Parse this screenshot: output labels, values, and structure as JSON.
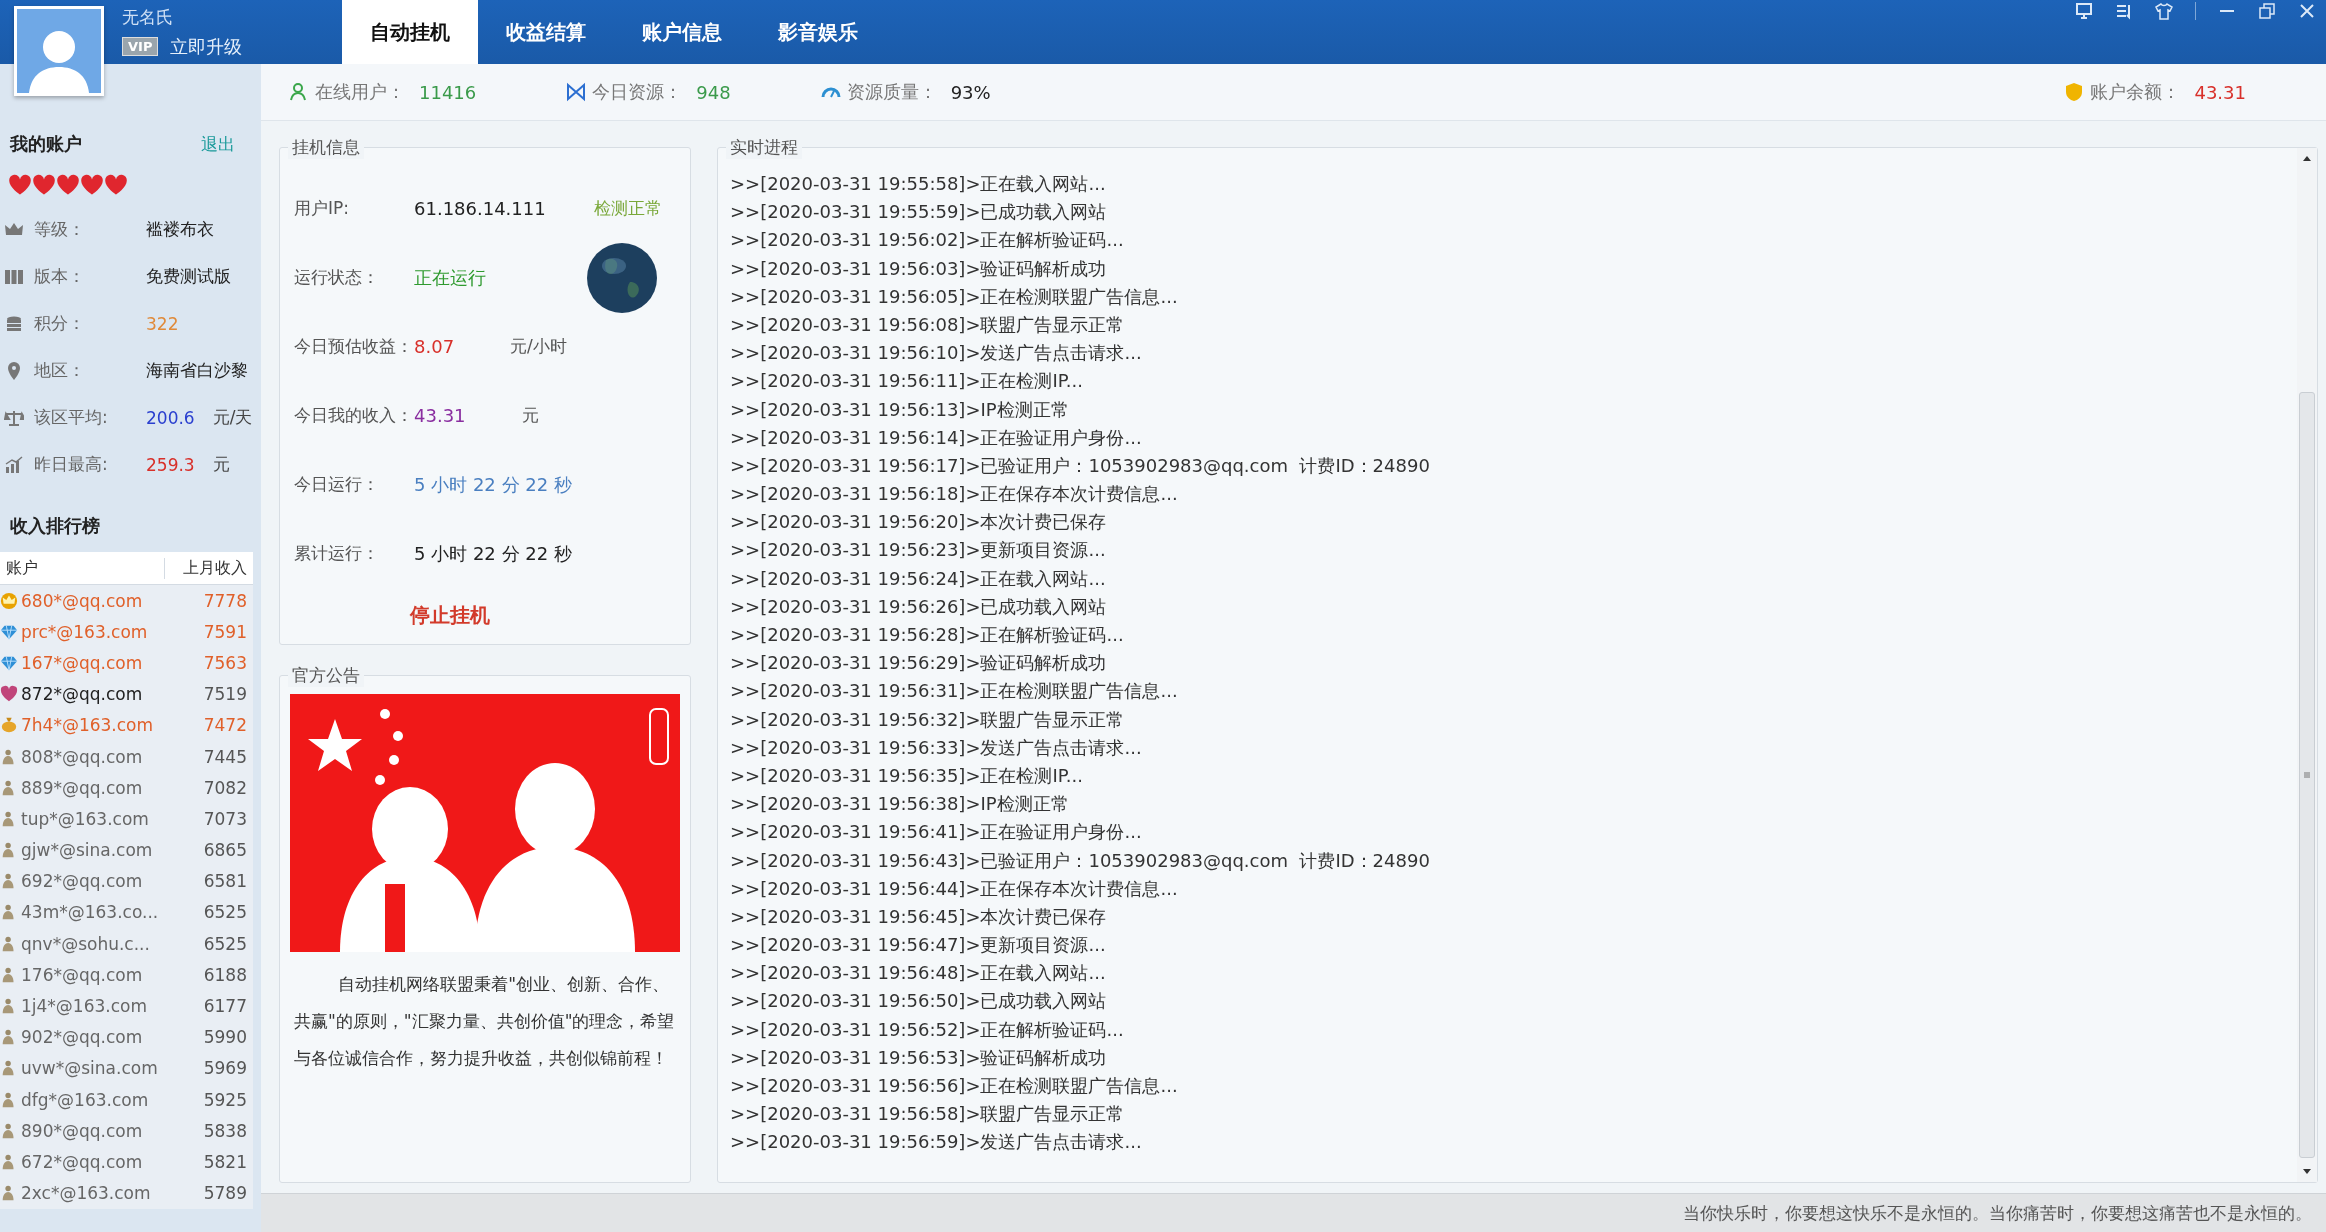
{
  "header": {
    "user_name": "无名氏",
    "vip_badge": "VIP",
    "upgrade_link": "立即升级",
    "tabs": [
      {
        "label": "自动挂机",
        "selected": true
      },
      {
        "label": "收益结算",
        "selected": false
      },
      {
        "label": "账户信息",
        "selected": false
      },
      {
        "label": "影音娱乐",
        "selected": false
      }
    ]
  },
  "stats": [
    {
      "kind": "users",
      "label": "在线用户：",
      "value": "11416"
    },
    {
      "kind": "resources",
      "label": "今日资源：",
      "value": "948"
    },
    {
      "kind": "quality",
      "label": "资源质量：",
      "value": "93%"
    },
    {
      "kind": "balance",
      "label": "账户余额：",
      "value": "43.31"
    }
  ],
  "account": {
    "title": "我的账户",
    "logout": "退出",
    "stars": 5,
    "rows": [
      {
        "kind": "level",
        "label": "等级：",
        "value": "褴褛布衣",
        "color": "#222222"
      },
      {
        "kind": "version",
        "label": "版本：",
        "value": "免费测试版",
        "color": "#222222"
      },
      {
        "kind": "points",
        "label": "积分：",
        "value": "322",
        "color": "#e08a3a"
      },
      {
        "kind": "region",
        "label": "地区：",
        "value": "海南省白沙黎",
        "color": "#222222"
      },
      {
        "kind": "average",
        "label": "该区平均:",
        "value": "200.6",
        "unit": "元/天",
        "color": "#2a3fcf"
      },
      {
        "kind": "best",
        "label": "昨日最高:",
        "value": "259.3",
        "unit": "元",
        "color": "#d8302a"
      }
    ]
  },
  "ranking": {
    "title": "收入排行榜",
    "columns": [
      "账户",
      "上月收入"
    ],
    "rows": [
      {
        "kind": "crown",
        "account": "680*@qq.com",
        "income": "7778"
      },
      {
        "kind": "diamond",
        "account": "prc*@163.com",
        "income": "7591"
      },
      {
        "kind": "diamond",
        "account": "167*@qq.com",
        "income": "7563"
      },
      {
        "kind": "heart",
        "account": "872*@qq.com",
        "income": "7519"
      },
      {
        "kind": "bag",
        "account": "7h4*@163.com",
        "income": "7472"
      },
      {
        "kind": "person",
        "account": "808*@qq.com",
        "income": "7445"
      },
      {
        "kind": "person",
        "account": "889*@qq.com",
        "income": "7082"
      },
      {
        "kind": "person",
        "account": "tup*@163.com",
        "income": "7073"
      },
      {
        "kind": "person",
        "account": "gjw*@sina.com",
        "income": "6865"
      },
      {
        "kind": "person",
        "account": "692*@qq.com",
        "income": "6581"
      },
      {
        "kind": "person",
        "account": "43m*@163.co...",
        "income": "6525"
      },
      {
        "kind": "person",
        "account": "qnv*@sohu.c...",
        "income": "6525"
      },
      {
        "kind": "person",
        "account": "176*@qq.com",
        "income": "6188"
      },
      {
        "kind": "person",
        "account": "1j4*@163.com",
        "income": "6177"
      },
      {
        "kind": "person",
        "account": "902*@qq.com",
        "income": "5990"
      },
      {
        "kind": "person",
        "account": "uvw*@sina.com",
        "income": "5969"
      },
      {
        "kind": "person",
        "account": "dfg*@163.com",
        "income": "5925"
      },
      {
        "kind": "person",
        "account": "890*@qq.com",
        "income": "5838"
      },
      {
        "kind": "person",
        "account": "672*@qq.com",
        "income": "5821"
      },
      {
        "kind": "person",
        "account": "2xc*@163.com",
        "income": "5789"
      }
    ]
  },
  "hangup": {
    "title": "挂机信息",
    "rows": [
      {
        "label": "用户IP:",
        "value": "61.186.14.111",
        "color": "#222222",
        "note": "检测正常"
      },
      {
        "label": "运行状态：",
        "value": "正在运行",
        "color": "#2f9a2f"
      },
      {
        "label": "今日预估收益：",
        "value": "8.07",
        "color": "#d8302a",
        "unit": "元/小时"
      },
      {
        "label": "今日我的收入：",
        "value": "43.31",
        "color": "#8a2ea0",
        "unit": "元"
      },
      {
        "label": "今日运行：",
        "value": "5 小时 22 分 22 秒",
        "color": "#4a7fc0"
      },
      {
        "label": "累计运行：",
        "value": "5 小时 22 分 22 秒",
        "color": "#222222"
      }
    ],
    "stop_button": "停止挂机"
  },
  "notice": {
    "title": "官方公告",
    "text": "自动挂机网络联盟秉着\"创业、创新、合作、共赢\"的原则，\"汇聚力量、共创价值\"的理念，希望与各位诚信合作，努力提升收益，共创似锦前程！"
  },
  "log": {
    "title": "实时进程",
    "lines": [
      ">>[2020-03-31 19:55:58]>正在载入网站...",
      ">>[2020-03-31 19:55:59]>已成功载入网站",
      ">>[2020-03-31 19:56:02]>正在解析验证码...",
      ">>[2020-03-31 19:56:03]>验证码解析成功",
      ">>[2020-03-31 19:56:05]>正在检测联盟广告信息...",
      ">>[2020-03-31 19:56:08]>联盟广告显示正常",
      ">>[2020-03-31 19:56:10]>发送广告点击请求...",
      ">>[2020-03-31 19:56:11]>正在检测IP...",
      ">>[2020-03-31 19:56:13]>IP检测正常",
      ">>[2020-03-31 19:56:14]>正在验证用户身份...",
      ">>[2020-03-31 19:56:17]>已验证用户：1053902983@qq.com  计费ID：24890",
      ">>[2020-03-31 19:56:18]>正在保存本次计费信息...",
      ">>[2020-03-31 19:56:20]>本次计费已保存",
      ">>[2020-03-31 19:56:23]>更新项目资源...",
      ">>[2020-03-31 19:56:24]>正在载入网站...",
      ">>[2020-03-31 19:56:26]>已成功载入网站",
      ">>[2020-03-31 19:56:28]>正在解析验证码...",
      ">>[2020-03-31 19:56:29]>验证码解析成功",
      ">>[2020-03-31 19:56:31]>正在检测联盟广告信息...",
      ">>[2020-03-31 19:56:32]>联盟广告显示正常",
      ">>[2020-03-31 19:56:33]>发送广告点击请求...",
      ">>[2020-03-31 19:56:35]>正在检测IP...",
      ">>[2020-03-31 19:56:38]>IP检测正常",
      ">>[2020-03-31 19:56:41]>正在验证用户身份...",
      ">>[2020-03-31 19:56:43]>已验证用户：1053902983@qq.com  计费ID：24890",
      ">>[2020-03-31 19:56:44]>正在保存本次计费信息...",
      ">>[2020-03-31 19:56:45]>本次计费已保存",
      ">>[2020-03-31 19:56:47]>更新项目资源...",
      ">>[2020-03-31 19:56:48]>正在载入网站...",
      ">>[2020-03-31 19:56:50]>已成功载入网站",
      ">>[2020-03-31 19:56:52]>正在解析验证码...",
      ">>[2020-03-31 19:56:53]>验证码解析成功",
      ">>[2020-03-31 19:56:56]>正在检测联盟广告信息...",
      ">>[2020-03-31 19:56:58]>联盟广告显示正常",
      ">>[2020-03-31 19:56:59]>发送广告点击请求..."
    ]
  },
  "status_bar": "当你快乐时，你要想这快乐不是永恒的。当你痛苦时，你要想这痛苦也不是永恒的。"
}
